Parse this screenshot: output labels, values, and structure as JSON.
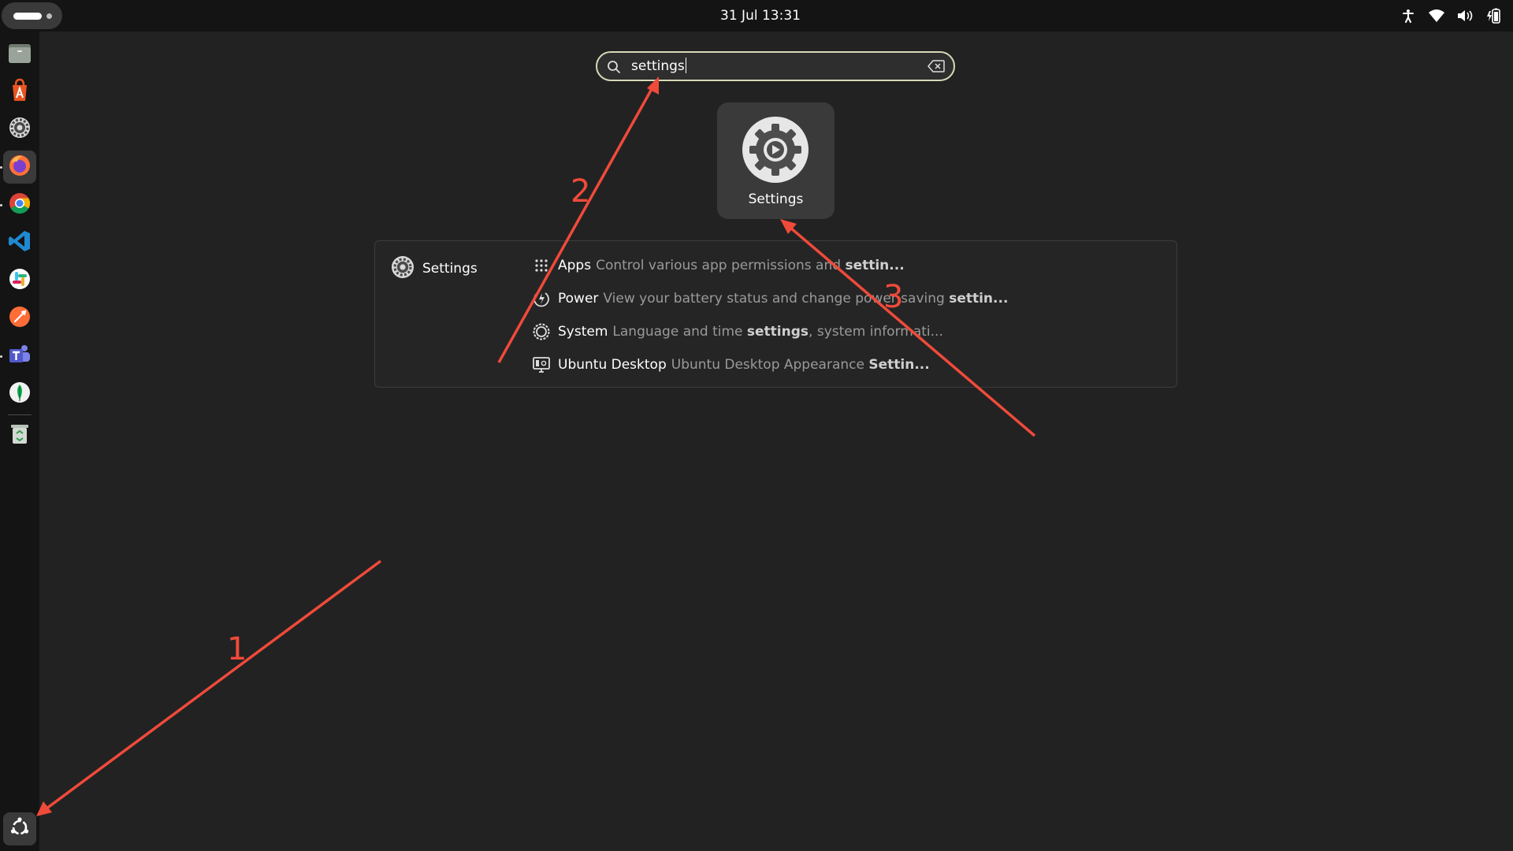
{
  "topbar": {
    "clock": "31 Jul  13:31",
    "tray_icons": [
      "accessibility-icon",
      "wifi-icon",
      "volume-icon",
      "battery-icon"
    ]
  },
  "dock": {
    "apps": [
      {
        "name": "files-icon"
      },
      {
        "name": "app-center-icon"
      },
      {
        "name": "settings-icon"
      },
      {
        "name": "firefox-icon"
      },
      {
        "name": "chrome-icon"
      },
      {
        "name": "vscode-icon"
      },
      {
        "name": "slack-icon"
      },
      {
        "name": "postman-icon"
      },
      {
        "name": "teams-icon"
      },
      {
        "name": "mongodb-compass-icon"
      },
      {
        "name": "trash-icon"
      }
    ],
    "show_apps_icon": "ubuntu-logo-icon"
  },
  "search": {
    "value": "settings"
  },
  "app_result": {
    "label": "Settings",
    "icon": "gear-icon"
  },
  "provider": {
    "label": "Settings",
    "icon": "gear-icon"
  },
  "results": [
    {
      "title": "Apps",
      "desc_pre": "Control various app permissions and ",
      "desc_bold": "settin...",
      "desc_post": "",
      "icon": "apps-grid-icon"
    },
    {
      "title": "Power",
      "desc_pre": "View your battery status and change power saving ",
      "desc_bold": "settin...",
      "desc_post": "",
      "icon": "power-icon"
    },
    {
      "title": "System",
      "desc_pre": "Language and time ",
      "desc_bold": "settings",
      "desc_post": ", system informati...",
      "icon": "system-gear-icon"
    },
    {
      "title": "Ubuntu Desktop",
      "desc_pre": "Ubuntu Desktop Appearance ",
      "desc_bold": "Settin...",
      "desc_post": "",
      "icon": "desktop-icon"
    }
  ],
  "annotations": {
    "numbers": [
      "1",
      "2",
      "3"
    ],
    "color": "#f04a3a"
  },
  "colors": {
    "background": "#222222",
    "topbar": "#141414",
    "search_border": "#d8d8b8",
    "annotation": "#f04a3a"
  }
}
